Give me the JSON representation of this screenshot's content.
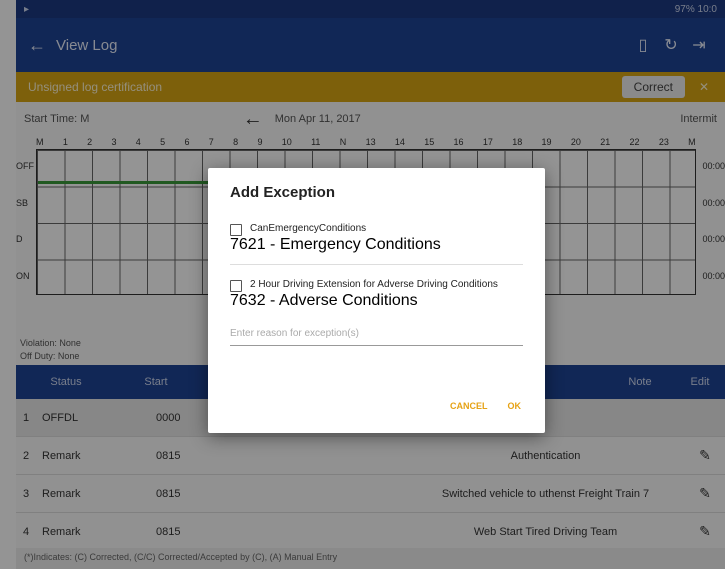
{
  "statusbar": {
    "time": "10:0",
    "battery": "97%"
  },
  "toolbar": {
    "title": "View Log"
  },
  "banner": {
    "text": "Unsigned log certification",
    "button": "Correct"
  },
  "log": {
    "left_label": "Start Time: M",
    "date": "Mon Apr 11, 2017",
    "right_label": "Intermit"
  },
  "graph": {
    "hours": [
      "M",
      "1",
      "2",
      "3",
      "4",
      "5",
      "6",
      "7",
      "8",
      "9",
      "10",
      "11",
      "N",
      "13",
      "14",
      "15",
      "16",
      "17",
      "18",
      "19",
      "20",
      "21",
      "22",
      "23",
      "M"
    ],
    "rows": [
      "OFF",
      "SB",
      "D",
      "ON"
    ],
    "totals": [
      "00:00",
      "00:00",
      "00:00",
      "00:00"
    ],
    "notes": [
      "Violation: None",
      "Off Duty: None"
    ]
  },
  "table": {
    "headers": [
      "Status",
      "Start",
      "",
      "Note",
      "Edit"
    ],
    "rows": [
      {
        "idx": "1",
        "status": "OFFDL",
        "start": "0000",
        "note": ""
      },
      {
        "idx": "2",
        "status": "Remark",
        "start": "0815",
        "note": "Authentication"
      },
      {
        "idx": "3",
        "status": "Remark",
        "start": "0815",
        "note": "Switched vehicle to uthenst Freight Train 7"
      },
      {
        "idx": "4",
        "status": "Remark",
        "start": "0815",
        "note": "Web Start Tired Driving Team"
      }
    ]
  },
  "footer": {
    "text": "(*)Indicates: (C) Corrected, (C/C) Corrected/Accepted by (C), (A) Manual Entry"
  },
  "dialog": {
    "title": "Add Exception",
    "options": [
      {
        "label": "CanEmergencyConditions",
        "sub": "7621 - Emergency Conditions"
      },
      {
        "label": "2 Hour Driving Extension for Adverse Driving Conditions",
        "sub": "7632 - Adverse Conditions"
      }
    ],
    "reason_placeholder": "Enter reason for exception(s)",
    "cancel": "CANCEL",
    "ok": "OK"
  },
  "colors": {
    "primary": "#1e4494",
    "accent": "#d8a514",
    "action": "#e6a214"
  }
}
